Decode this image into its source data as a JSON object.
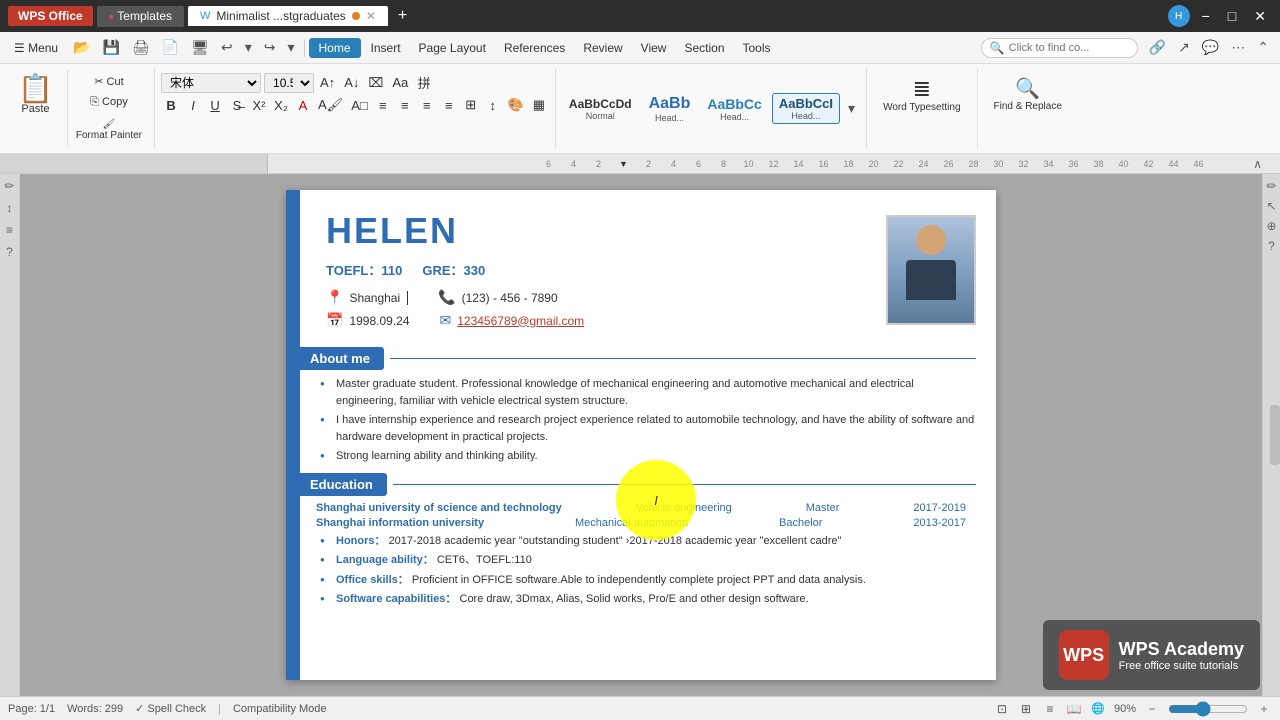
{
  "titlebar": {
    "wps_label": "WPS Office",
    "templates_label": "Templates",
    "doc_tab_label": "Minimalist ...stgraduates",
    "add_tab_label": "+",
    "avatar_label": "H",
    "minimize": "−",
    "maximize": "□",
    "close": "✕"
  },
  "menubar": {
    "menu": "☰ Menu",
    "home": "Home",
    "insert": "Insert",
    "page_layout": "Page Layout",
    "references": "References",
    "review": "Review",
    "view": "View",
    "section": "Section",
    "tools": "Tools",
    "search_placeholder": "Click to find co...",
    "find_replace": "Find & Replace"
  },
  "ribbon": {
    "clipboard": {
      "paste_label": "Paste",
      "cut_label": "Cut",
      "copy_label": "Copy",
      "format_painter_label": "Format Painter"
    },
    "font": {
      "font_name": "宋体",
      "font_size": "10.5"
    },
    "styles": {
      "normal_label": "Normal",
      "heading1_label": "Head...",
      "heading2_label": "Head...",
      "heading3_label": "Head..."
    },
    "word_typeset_label": "Word Typesetting",
    "find_replace_label": "Find & Replace"
  },
  "resume": {
    "name": "HELEN",
    "toefl_label": "TOEFL：",
    "toefl_score": "110",
    "gre_label": "GRE：",
    "gre_score": "330",
    "city": "Shanghai",
    "dob": "1998.09.24",
    "phone": "(123)  - 456 - 7890",
    "email": "123456789@gmail.com",
    "about_me_label": "About me",
    "about_bullets": [
      "Master graduate student. Professional knowledge of mechanical engineering and automotive mechanical and electrical engineering, familiar with vehicle electrical system structure.",
      "I have internship experience and research project experience related to automobile technology, and have the ability of software and hardware development in practical projects.",
      "Strong learning ability and thinking ability."
    ],
    "education_label": "Education",
    "edu_rows": [
      {
        "school": "Shanghai university of science and technology",
        "field": "Vehicle engineering",
        "degree": "Master",
        "years": "2017-2019"
      },
      {
        "school": "Shanghai information university",
        "field": "Mechanical automation",
        "degree": "Bachelor",
        "years": "2013-2017"
      }
    ],
    "honors_label": "Honors：",
    "honors_text": "2017-2018 academic year \"outstanding student\" ›2017-2018 academic year \"excellent cadre\"",
    "language_label": "Language ability：",
    "language_text": "CET6、TOEFL:110",
    "office_label": "Office skills：",
    "office_text": "Proficient in OFFICE software.Able to independently complete project PPT and data analysis.",
    "software_label": "Software capabilities：",
    "software_text": "Core draw, 3Dmax, Alias, Solid works, Pro/E and other design software."
  },
  "statusbar": {
    "page": "Page: 1/1",
    "words": "Words: 299",
    "spell_check": "✓ Spell Check",
    "compat_mode": "Compatibility Mode",
    "zoom_level": "90%"
  },
  "wps_academy": {
    "logo": "WPS",
    "title": "WPS Academy",
    "subtitle": "Free office suite tutorials"
  }
}
